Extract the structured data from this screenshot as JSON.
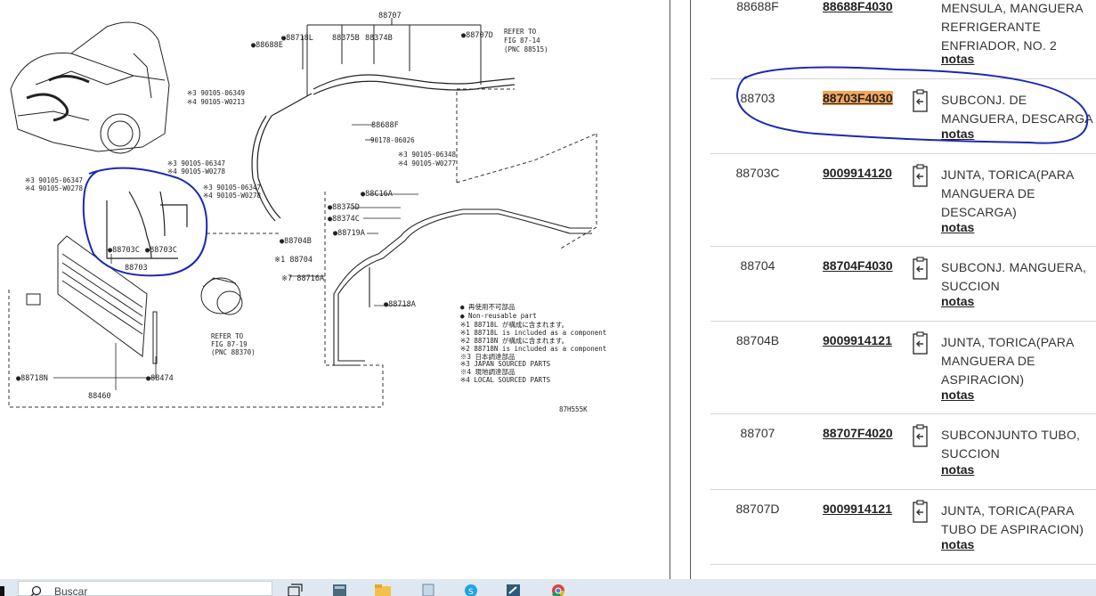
{
  "diagram": {
    "labels": {
      "top_assembly": "88707",
      "l_88688e": "●88688E",
      "l_88718l": "●88718L",
      "l_88375b": "88375B",
      "l_88374b": "88374B",
      "l_88707d": "●88707D",
      "refer_top": [
        "REFER TO",
        "FIG 87-14",
        "(PNC 88515)"
      ],
      "l_90105_06349": "※3 90105-06349",
      "l_90105_w0213": "※4 90105-W0213",
      "l_88688f": "88688F",
      "l_90178": "90178-06026",
      "l_90105_06348": "※3 90105-06348",
      "l_90105_w0277": "※4 90105-W0277",
      "l_90105_06347_a": "※3 90105-06347",
      "l_90105_w0278_a": "※4 90105-W0278",
      "l_90105_06347_b": "※3 90105-06347",
      "l_90105_w0278_b": "※4 90105-W0278",
      "l_90105_06347_c": "※3 90105-06347",
      "l_90105_w0278_c": "※4 90105-W0278",
      "l_88703c_a": "●88703C",
      "l_88703c_b": "●88703C",
      "l_88703": "88703",
      "l_88704b": "●88704B",
      "l_88704": "※1 88704",
      "l_88716a": "※7 88716A",
      "l_88c16a": "●88C16A",
      "l_88375d": "●88375D",
      "l_88374c": "●88374C",
      "l_88719a": "●88719A",
      "l_88718a": "●88718A",
      "refer_compressor": [
        "REFER TO",
        "FIG 87-19",
        "(PNC 88370)"
      ],
      "l_88718n": "●88718N",
      "l_88474": "●88474",
      "l_88460": "88460",
      "figure_code": "87H555K"
    },
    "legend": [
      "● 再使用不可部品",
      "● Non-reusable part",
      "※1 88718L が構成に含まれます。",
      "※1 88718L is included as a component",
      "※2 88718N が構成に含まれます。",
      "※2 88718N is included as a component",
      "※3 日本調達部品",
      "※3 JAPAN SOURCED PARTS",
      "※4 現地調達部品",
      "※4 LOCAL SOURCED PARTS"
    ],
    "annotation_color": "#1a28b4"
  },
  "parts": [
    {
      "pnc": "88688F",
      "part_no": "88688F4030",
      "desc": "MENSULA, MANGUERA REFRIGERANTE ENFRIADOR, NO. 2",
      "notes": "notas",
      "highlight": false
    },
    {
      "pnc": "88703",
      "part_no": "88703F4030",
      "desc": "SUBCONJ. DE MANGUERA, DESCARGA",
      "notes": "notas",
      "highlight": true
    },
    {
      "pnc": "88703C",
      "part_no": "9009914120",
      "desc": "JUNTA, TORICA(PARA MANGUERA DE DESCARGA)",
      "notes": "notas",
      "highlight": false
    },
    {
      "pnc": "88704",
      "part_no": "88704F4030",
      "desc": "SUBCONJ. MANGUERA, SUCCION",
      "notes": "notas",
      "highlight": false
    },
    {
      "pnc": "88704B",
      "part_no": "9009914121",
      "desc": "JUNTA, TORICA(PARA MANGUERA DE ASPIRACION)",
      "notes": "notas",
      "highlight": false
    },
    {
      "pnc": "88707",
      "part_no": "88707F4020",
      "desc": "SUBCONJUNTO TUBO, SUCCION",
      "notes": "notas",
      "highlight": false
    },
    {
      "pnc": "88707D",
      "part_no": "9009914121",
      "desc": "JUNTA, TORICA(PARA TUBO DE ASPIRACION)",
      "notes": "notas",
      "highlight": false
    }
  ],
  "taskbar": {
    "search_placeholder": "Buscar",
    "icons": [
      "task-view-icon",
      "calculator-icon",
      "file-explorer-icon",
      "notepad-icon",
      "skype-icon",
      "app-icon",
      "chrome-icon"
    ]
  },
  "colors": {
    "highlight": "#f5a65b",
    "annotation": "#1a28b4",
    "taskbar": "#dfe7f0"
  }
}
